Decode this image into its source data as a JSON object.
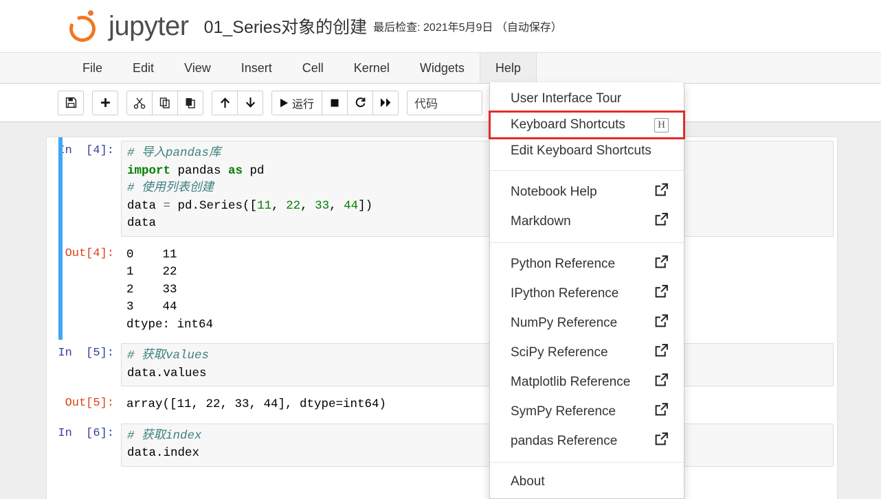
{
  "header": {
    "logo_name": "jupyter-logo",
    "wordmark": "jupyter",
    "notebook_title": "01_Series对象的创建",
    "checkpoint": "最后检查: 2021年5月9日 （自动保存）"
  },
  "menubar": {
    "items": [
      {
        "label": "File",
        "active": false
      },
      {
        "label": "Edit",
        "active": false
      },
      {
        "label": "View",
        "active": false
      },
      {
        "label": "Insert",
        "active": false
      },
      {
        "label": "Cell",
        "active": false
      },
      {
        "label": "Kernel",
        "active": false
      },
      {
        "label": "Widgets",
        "active": false
      },
      {
        "label": "Help",
        "active": true
      }
    ]
  },
  "toolbar": {
    "save_icon": "save-icon",
    "insert_icon": "plus-icon",
    "cut_icon": "scissors-icon",
    "copy_icon": "copy-icon",
    "paste_icon": "paste-icon",
    "move_up_icon": "arrow-up-icon",
    "move_down_icon": "arrow-down-icon",
    "run_label": "运行",
    "run_icon": "play-icon",
    "stop_icon": "stop-square-icon",
    "restart_icon": "restart-circle-icon",
    "restart_run_all_icon": "fast-forward-icon",
    "cell_type_value": "代码"
  },
  "help_menu": {
    "groups": [
      {
        "items": [
          {
            "label": "User Interface Tour",
            "kbd": "",
            "external": false,
            "highlight": false
          },
          {
            "label": "Keyboard Shortcuts",
            "kbd": "H",
            "external": false,
            "highlight": true
          },
          {
            "label": "Edit Keyboard Shortcuts",
            "kbd": "",
            "external": false,
            "highlight": false
          }
        ]
      },
      {
        "items": [
          {
            "label": "Notebook Help",
            "kbd": "",
            "external": true,
            "highlight": false
          },
          {
            "label": "Markdown",
            "kbd": "",
            "external": true,
            "highlight": false
          }
        ]
      },
      {
        "items": [
          {
            "label": "Python Reference",
            "kbd": "",
            "external": true,
            "highlight": false
          },
          {
            "label": "IPython Reference",
            "kbd": "",
            "external": true,
            "highlight": false
          },
          {
            "label": "NumPy Reference",
            "kbd": "",
            "external": true,
            "highlight": false
          },
          {
            "label": "SciPy Reference",
            "kbd": "",
            "external": true,
            "highlight": false
          },
          {
            "label": "Matplotlib Reference",
            "kbd": "",
            "external": true,
            "highlight": false
          },
          {
            "label": "SymPy Reference",
            "kbd": "",
            "external": true,
            "highlight": false
          },
          {
            "label": "pandas Reference",
            "kbd": "",
            "external": true,
            "highlight": false
          }
        ]
      },
      {
        "items": [
          {
            "label": "About",
            "kbd": "",
            "external": false,
            "highlight": false
          }
        ]
      }
    ]
  },
  "notebook": {
    "cells": [
      {
        "kind": "input",
        "prompt": "In  [4]:",
        "selected": true,
        "lines": [
          {
            "parts": [
              {
                "t": "# 导入pandas库",
                "c": "tok-comment"
              }
            ]
          },
          {
            "parts": [
              {
                "t": "import",
                "c": "tok-kw"
              },
              {
                "t": " pandas ",
                "c": ""
              },
              {
                "t": "as",
                "c": "tok-kw"
              },
              {
                "t": " pd",
                "c": ""
              }
            ]
          },
          {
            "parts": [
              {
                "t": "# 使用列表创建",
                "c": "tok-comment"
              }
            ]
          },
          {
            "parts": [
              {
                "t": "data ",
                "c": ""
              },
              {
                "t": "=",
                "c": "tok-op"
              },
              {
                "t": " pd.Series([",
                "c": ""
              },
              {
                "t": "11",
                "c": "tok-num"
              },
              {
                "t": ", ",
                "c": ""
              },
              {
                "t": "22",
                "c": "tok-num"
              },
              {
                "t": ", ",
                "c": ""
              },
              {
                "t": "33",
                "c": "tok-num"
              },
              {
                "t": ", ",
                "c": ""
              },
              {
                "t": "44",
                "c": "tok-num"
              },
              {
                "t": "])",
                "c": ""
              }
            ]
          },
          {
            "parts": [
              {
                "t": "data",
                "c": ""
              }
            ]
          }
        ]
      },
      {
        "kind": "output",
        "prompt": "Out[4]:",
        "selected": true,
        "text": "0    11\n1    22\n2    33\n3    44\ndtype: int64"
      },
      {
        "kind": "input",
        "prompt": "In  [5]:",
        "selected": false,
        "lines": [
          {
            "parts": [
              {
                "t": "# 获取values",
                "c": "tok-comment"
              }
            ]
          },
          {
            "parts": [
              {
                "t": "data.values",
                "c": ""
              }
            ]
          }
        ]
      },
      {
        "kind": "output",
        "prompt": "Out[5]:",
        "selected": false,
        "text": "array([11, 22, 33, 44], dtype=int64)"
      },
      {
        "kind": "input",
        "prompt": "In  [6]:",
        "selected": false,
        "lines": [
          {
            "parts": [
              {
                "t": "# 获取index",
                "c": "tok-comment"
              }
            ]
          },
          {
            "parts": [
              {
                "t": "data.index",
                "c": ""
              }
            ]
          }
        ]
      }
    ]
  },
  "colors": {
    "brand_orange": "#f37726",
    "selected_cell_bar": "#42a5f5",
    "in_prompt": "#303f9f",
    "out_prompt": "#d84315",
    "highlight_box": "#e02b2b",
    "comment": "#408080",
    "keyword": "#008000"
  }
}
